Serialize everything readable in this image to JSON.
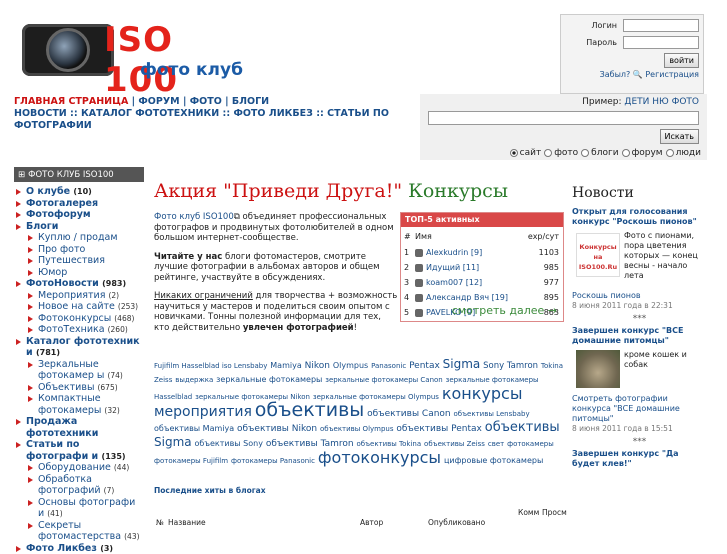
{
  "logo": {
    "iso": "ISO 100",
    "club": "фото клуб"
  },
  "login": {
    "login_label": "Логин",
    "password_label": "Пароль",
    "submit": "войти",
    "forgot": "Забыл?",
    "register": "Регистрация"
  },
  "nav": {
    "row1": [
      "ГЛАВНАЯ СТРАНИЦА",
      "ФОРУМ",
      "ФОТО",
      "БЛОГИ"
    ],
    "row2": [
      "НОВОСТИ",
      "КАТАЛОГ ФОТОТЕХНИКИ",
      "ФОТО ЛИКБЕЗ",
      "СТАТЬИ ПО ФОТОГРАФИИ"
    ]
  },
  "search": {
    "example_label": "Пример:",
    "example_value": "ДЕТИ НЮ ФОТО",
    "button": "Искать",
    "options": [
      "сайт",
      "фото",
      "блоги",
      "форум",
      "люди"
    ],
    "selected": "сайт"
  },
  "sidebar": {
    "header": "ФОТО КЛУБ ISO100",
    "items": [
      {
        "label": "О клубе",
        "count": "(10)",
        "level": "b"
      },
      {
        "label": "Фотогалерея",
        "count": "",
        "level": "b"
      },
      {
        "label": "Фотофорум",
        "count": "",
        "level": "b"
      },
      {
        "label": "Блоги",
        "count": "",
        "level": "b"
      },
      {
        "label": "Куплю / продам",
        "count": "",
        "level": "s"
      },
      {
        "label": "Про фото",
        "count": "",
        "level": "s"
      },
      {
        "label": "Путешествия",
        "count": "",
        "level": "s"
      },
      {
        "label": "Юмор",
        "count": "",
        "level": "s"
      },
      {
        "label": "ФотоНовости",
        "count": "(983)",
        "level": "b"
      },
      {
        "label": "Мероприятия",
        "count": "(2)",
        "level": "s"
      },
      {
        "label": "Новое на сайте",
        "count": "(253)",
        "level": "s"
      },
      {
        "label": "Фотоконкурсы",
        "count": "(468)",
        "level": "s"
      },
      {
        "label": "ФотоТехника",
        "count": "(260)",
        "level": "s"
      },
      {
        "label": "Каталог фототехник и",
        "count": "(781)",
        "level": "b"
      },
      {
        "label": "Зеркальные фотокамер ы",
        "count": "(74)",
        "level": "s"
      },
      {
        "label": "Объективы",
        "count": "(675)",
        "level": "s"
      },
      {
        "label": "Компактные фотокамеры",
        "count": "(32)",
        "level": "s"
      },
      {
        "label": "Продажа фототехники",
        "count": "",
        "level": "b"
      },
      {
        "label": "Статьи по фотографи и",
        "count": "(135)",
        "level": "b"
      },
      {
        "label": "Оборудование",
        "count": "(44)",
        "level": "s"
      },
      {
        "label": "Обработка фотографий",
        "count": "(7)",
        "level": "s"
      },
      {
        "label": "Основы фотографи и",
        "count": "(41)",
        "level": "s"
      },
      {
        "label": "Секреты фотомастерства",
        "count": "(43)",
        "level": "s"
      },
      {
        "label": "Фото Ликбез",
        "count": "(3)",
        "level": "b"
      }
    ]
  },
  "headline": {
    "red": "Акция \"Приведи Друга!\"",
    "green": "Конкурсы"
  },
  "intro": {
    "p1_link": "Фото клуб ISO100",
    "p1_text": " объединяет профессиональных фотографов и продвинутых фотолюбителей в одном большом интернет-сообществе.",
    "p2_bold": "Читайте у нас",
    "p2_text": " блоги фотомастеров, смотрите лучшие фотографии в альбомах авторов и общем рейтинге, участвуйте в обсуждениях.",
    "p3_under": "Никаких ограничений",
    "p3_text": " для творчества + возможность научиться у мастеров и поделиться своим опытом с новичками. Тонны полезной информации для тех, кто действительно ",
    "p3_bold": "увлечен фотографией",
    "p3_end": "!"
  },
  "top5": {
    "title": "ТОП-5 активных",
    "col_num": "#",
    "col_name": "Имя",
    "col_score": "exp/сут",
    "rows": [
      {
        "n": "1",
        "name": "Alexkudrin [9]",
        "v": "1103"
      },
      {
        "n": "2",
        "name": "Идущий [11]",
        "v": "985"
      },
      {
        "n": "3",
        "name": "koam007 [12]",
        "v": "977"
      },
      {
        "n": "4",
        "name": "Александр Вяч [19]",
        "v": "895"
      },
      {
        "n": "5",
        "name": "PAVELKO [9]",
        "v": "863"
      }
    ],
    "more": "смотреть далее →"
  },
  "tags": [
    {
      "t": "Fujifilm Hasselblad iso Lensbaby",
      "s": 7
    },
    {
      "t": "Mamiya",
      "s": 8
    },
    {
      "t": "Nikon",
      "s": 9
    },
    {
      "t": "Olympus",
      "s": 8
    },
    {
      "t": "Panasonic",
      "s": 7
    },
    {
      "t": "Pentax",
      "s": 9
    },
    {
      "t": "Sigma",
      "s": 12
    },
    {
      "t": "Sony Tamron",
      "s": 8.5
    },
    {
      "t": "Tokina Zeiss",
      "s": 7
    },
    {
      "t": "выдержка",
      "s": 7
    },
    {
      "t": "зеркальные фотокамеры",
      "s": 8
    },
    {
      "t": "зеркальные фотокамеры Canon",
      "s": 7
    },
    {
      "t": "зеркальные фотокамеры Hasselblad",
      "s": 7
    },
    {
      "t": "зеркальные фотокамеры Nikon",
      "s": 7
    },
    {
      "t": "зеркальные фотокамеры Olympus",
      "s": 7
    },
    {
      "t": "конкурсы",
      "s": 16
    },
    {
      "t": "мероприятия",
      "s": 14
    },
    {
      "t": "объективы",
      "s": 19
    },
    {
      "t": "объективы Canon",
      "s": 9
    },
    {
      "t": "объективы Lensbaby",
      "s": 7
    },
    {
      "t": "объективы Mamiya",
      "s": 8
    },
    {
      "t": "объективы Nikon",
      "s": 9
    },
    {
      "t": "объективы Olympus",
      "s": 7
    },
    {
      "t": "объективы Pentax",
      "s": 9
    },
    {
      "t": "объективы",
      "s": 13
    },
    {
      "t": "Sigma",
      "s": 12
    },
    {
      "t": "объективы Sony",
      "s": 8
    },
    {
      "t": "объективы Tamron",
      "s": 9
    },
    {
      "t": "объективы Tokina",
      "s": 7
    },
    {
      "t": "объективы Zeiss",
      "s": 7
    },
    {
      "t": "свет",
      "s": 7
    },
    {
      "t": "фотокамеры",
      "s": 7
    },
    {
      "t": "фотокамеры Fujifilm",
      "s": 7
    },
    {
      "t": "фотокамеры Panasonic",
      "s": 7
    },
    {
      "t": "фотоконкурсы",
      "s": 16
    },
    {
      "t": "цифровые фотокамеры",
      "s": 8
    }
  ],
  "hits": "Последние хиты в блогах",
  "table": {
    "num": "№",
    "name": "Название",
    "author": "Автор",
    "published": "Опубликовано",
    "comm": "Комм",
    "views": "Просм"
  },
  "news": {
    "title": "Новости",
    "items": [
      {
        "title": "Открыт для голосования конкурс \"Роскошь пионов\"",
        "img": "Конкурсы на ISO100.Ru",
        "body": "Фото с пионами, пора цветения которых — конец весны - начало лета",
        "link": "Роскошь пионов",
        "date": "8 июня 2011 года в 22:31"
      },
      {
        "title": "Завершен конкурс \"ВСЕ домашние питомцы\"",
        "body": "кроме кошек и собак",
        "link": "Смотреть фотографии конкурса \"ВСЕ домашние питомцы\"",
        "date": "8 июня 2011 года в 15:51"
      },
      {
        "title": "Завершен конкурс \"Да будет клев!\"",
        "body": "",
        "link": "",
        "date": ""
      }
    ],
    "sep": "***"
  }
}
